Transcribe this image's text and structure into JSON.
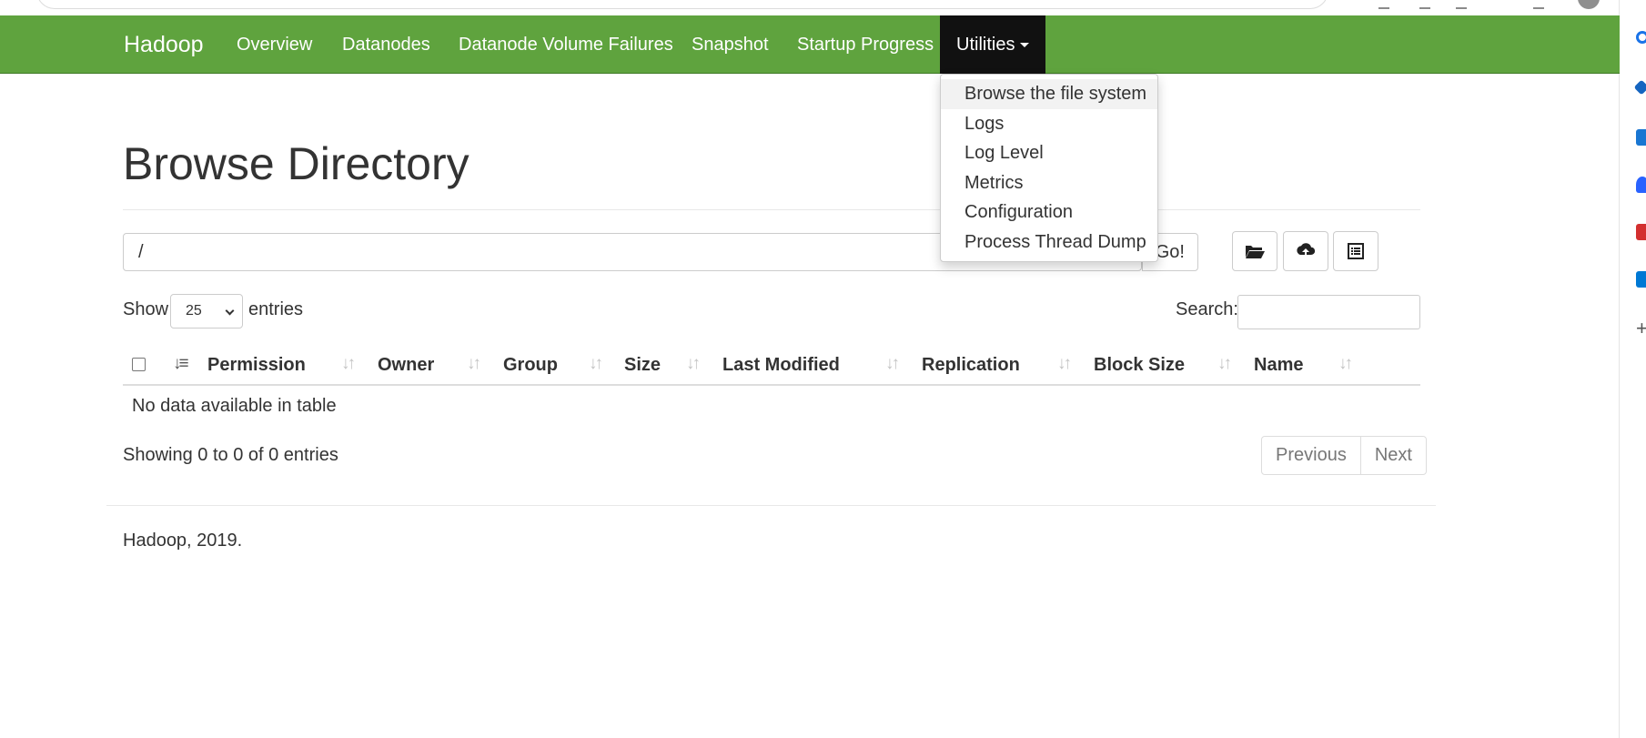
{
  "navbar": {
    "brand": "Hadoop",
    "items": [
      "Overview",
      "Datanodes",
      "Datanode Volume Failures",
      "Snapshot",
      "Startup Progress"
    ],
    "active": "Utilities",
    "bg_color": "#5fa33e"
  },
  "utilities_menu": {
    "items": [
      "Browse the file system",
      "Logs",
      "Log Level",
      "Metrics",
      "Configuration",
      "Process Thread Dump"
    ]
  },
  "page": {
    "title": "Browse Directory"
  },
  "directory": {
    "path": "/",
    "go_label": "Go!"
  },
  "toolbar": {
    "icons": [
      "folder-open-icon",
      "upload-cloud-icon",
      "list-icon"
    ]
  },
  "table_controls": {
    "show_label": "Show",
    "page_length": "25",
    "entries_label": "entries",
    "search_label": "Search:",
    "search_value": ""
  },
  "table": {
    "columns": [
      "Permission",
      "Owner",
      "Group",
      "Size",
      "Last Modified",
      "Replication",
      "Block Size",
      "Name"
    ],
    "empty_message": "No data available in table",
    "info": "Showing 0 to 0 of 0 entries"
  },
  "pagination": {
    "previous": "Previous",
    "next": "Next"
  },
  "footer": {
    "text": "Hadoop, 2019."
  }
}
